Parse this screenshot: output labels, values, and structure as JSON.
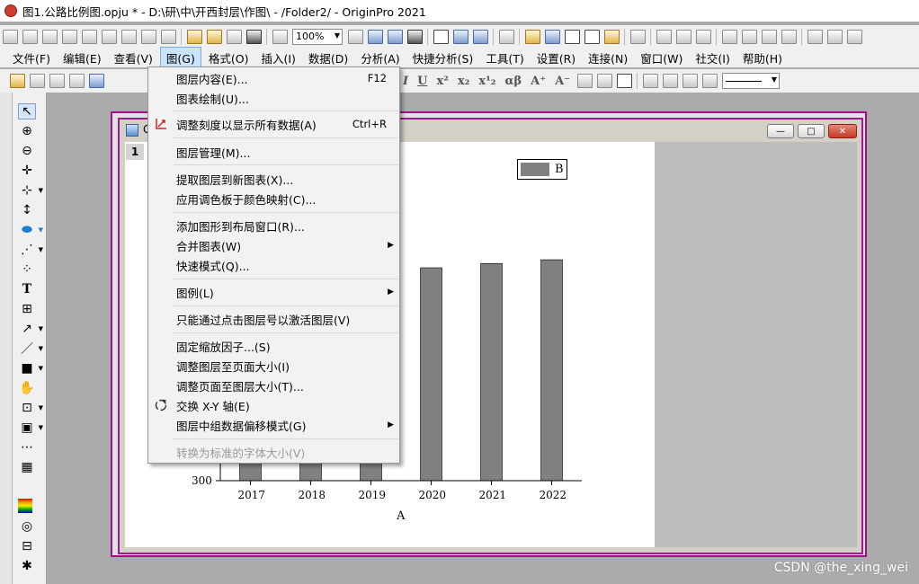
{
  "window": {
    "title": "图1.公路比例图.opju * - D:\\研\\中\\开西封层\\作图\\ - /Folder2/ - OriginPro 2021"
  },
  "toolbar": {
    "zoom": "100%",
    "font_size": "0"
  },
  "menubar": [
    {
      "label": "文件(F)"
    },
    {
      "label": "编辑(E)"
    },
    {
      "label": "查看(V)"
    },
    {
      "label": "图(G)"
    },
    {
      "label": "格式(O)"
    },
    {
      "label": "插入(I)"
    },
    {
      "label": "数据(D)"
    },
    {
      "label": "分析(A)"
    },
    {
      "label": "快捷分析(S)"
    },
    {
      "label": "工具(T)"
    },
    {
      "label": "设置(R)"
    },
    {
      "label": "连接(N)"
    },
    {
      "label": "窗口(W)"
    },
    {
      "label": "社交(I)"
    },
    {
      "label": "帮助(H)"
    }
  ],
  "graph_menu": [
    {
      "label": "图层内容(E)...",
      "shortcut": "F12"
    },
    {
      "label": "图表绘制(U)..."
    },
    {
      "label": "调整刻度以显示所有数据(A)",
      "shortcut": "Ctrl+R"
    },
    {
      "label": "图层管理(M)..."
    },
    {
      "label": "提取图层到新图表(X)..."
    },
    {
      "label": "应用调色板于颜色映射(C)..."
    },
    {
      "label": "添加图形到布局窗口(R)..."
    },
    {
      "label": "合并图表(W)"
    },
    {
      "label": "快速模式(Q)..."
    },
    {
      "label": "图例(L)"
    },
    {
      "label": "只能通过点击图层号以激活图层(V)"
    },
    {
      "label": "固定缩放因子...(S)"
    },
    {
      "label": "调整图层至页面大小(I)"
    },
    {
      "label": "调整页面至图层大小(T)..."
    },
    {
      "label": "交换 X-Y 轴(E)"
    },
    {
      "label": "图层中组数据偏移模式(G)"
    },
    {
      "label": "转换为标准的字体大小(V)"
    }
  ],
  "graph_window": {
    "title": "G",
    "layer": "1",
    "controls": {
      "minimize": "—",
      "maximize": "□",
      "close": "✕"
    }
  },
  "chart_data": {
    "type": "bar",
    "categories": [
      "2017",
      "2018",
      "2019",
      "2020",
      "2021",
      "2022"
    ],
    "visible_values": [
      null,
      null,
      null,
      1045,
      1060,
      1073
    ],
    "xlabel": "A",
    "ylabel": "",
    "legend": [
      "B"
    ],
    "legend_position": "top-right",
    "y_tick_visible": "300",
    "ylim_visible_min": 300,
    "bar_color": "#808080",
    "axes_visible": "partially hidden by menu"
  },
  "watermark": "CSDN @the_xing_wei"
}
